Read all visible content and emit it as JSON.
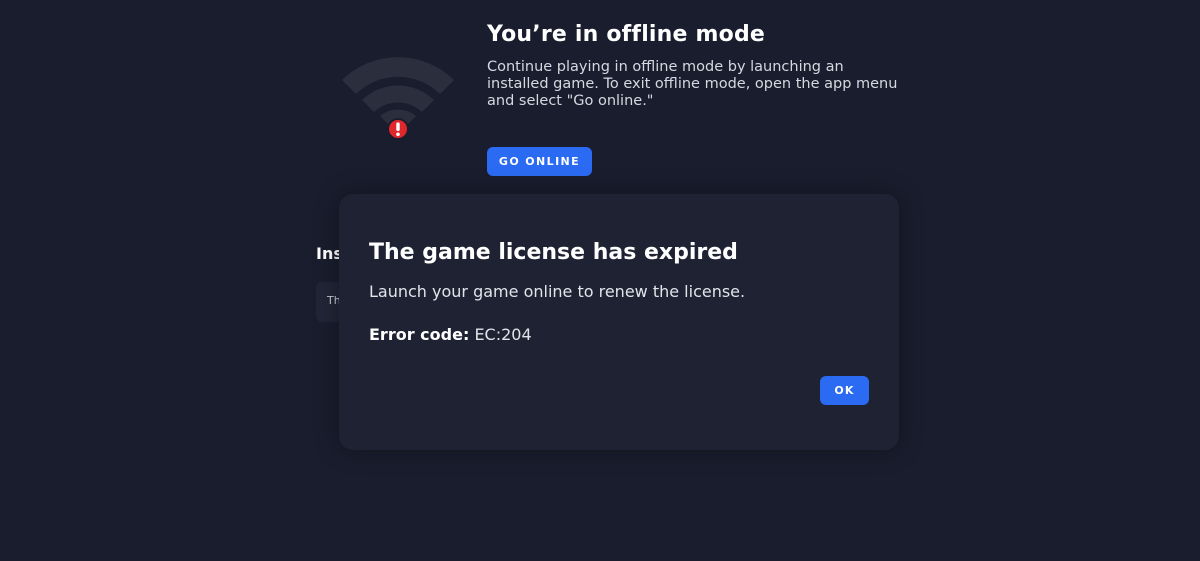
{
  "offline": {
    "title": "You’re in offline mode",
    "description": "Continue playing in offline mode by launching an installed game. To exit offline mode, open the app menu and select \"Go online.\"",
    "go_online_label": "GO ONLINE"
  },
  "installed": {
    "heading": "Ins",
    "card_text": "Th"
  },
  "dialog": {
    "title": "The game license has expired",
    "message": "Launch your game online to renew the license.",
    "error_label": "Error code:",
    "error_value": "EC:204",
    "ok_label": "OK"
  },
  "icons": {
    "status_icon": "wifi-offline-icon",
    "alert_icon": "alert-badge-icon"
  },
  "colors": {
    "background": "#1a1d2d",
    "dialog_background": "#1f2233",
    "accent": "#2b6bf3",
    "alert": "#e0272b"
  }
}
